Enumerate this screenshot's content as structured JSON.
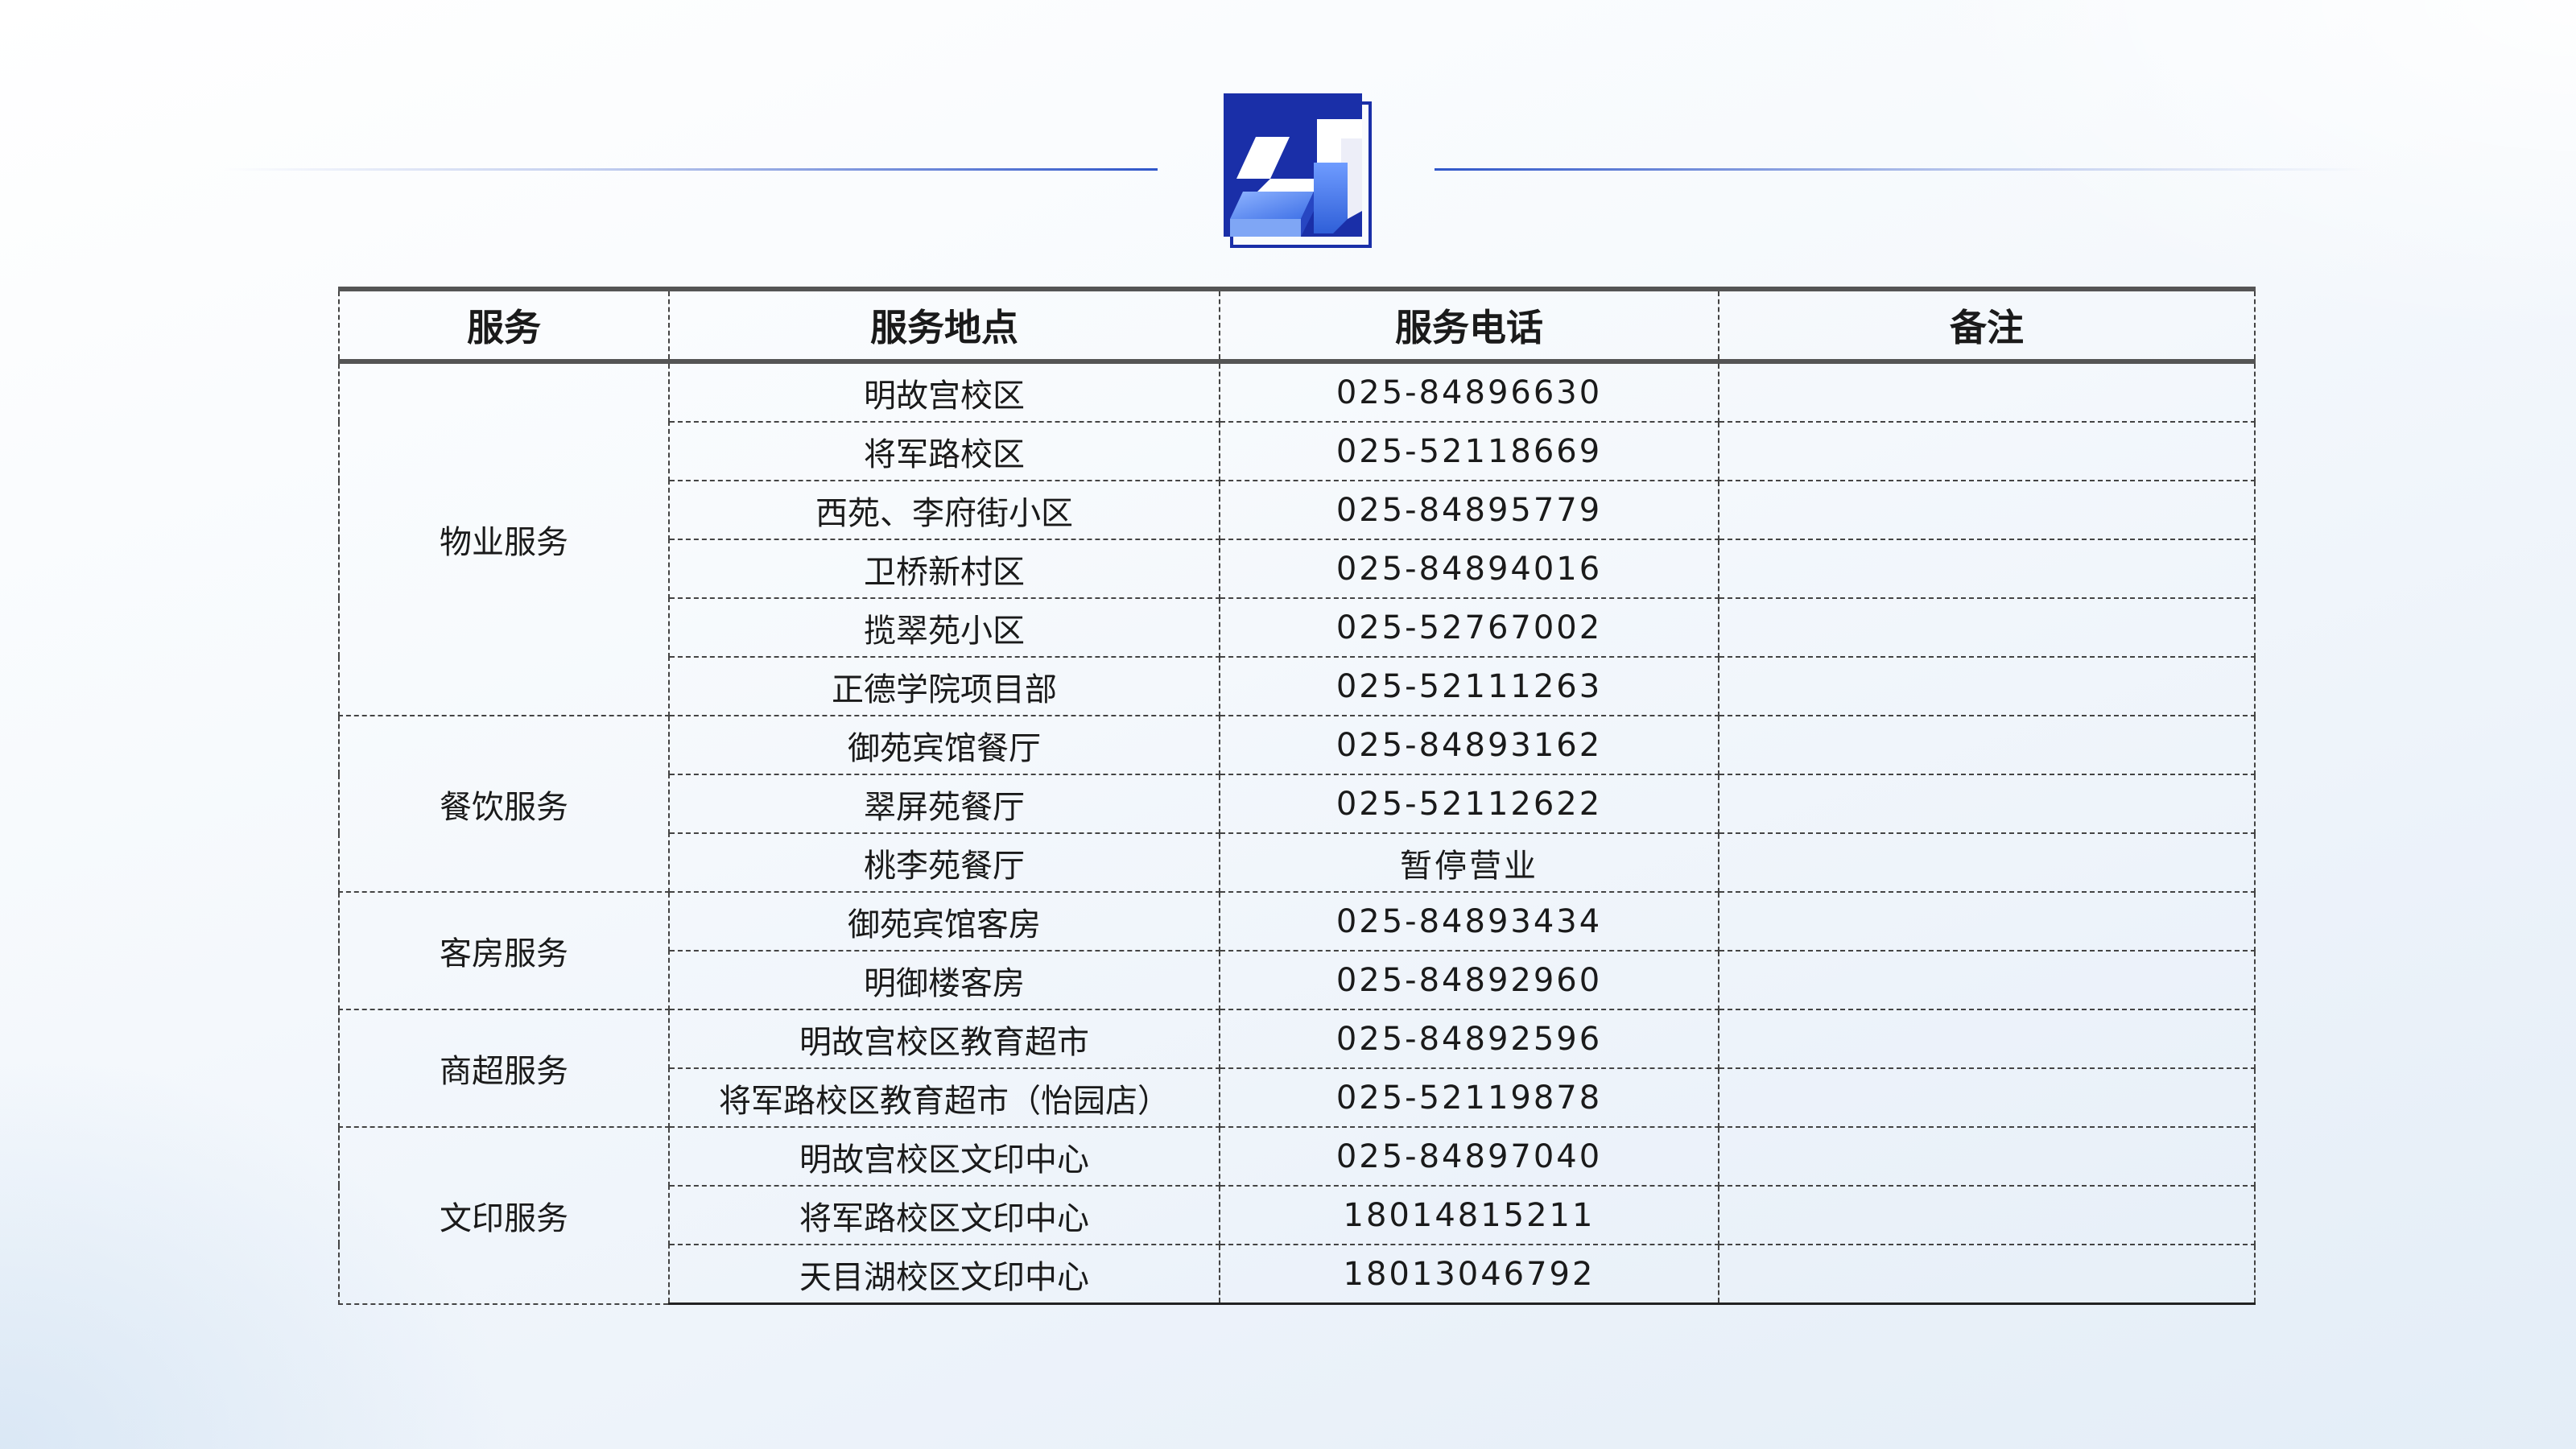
{
  "colors": {
    "accent_blue": "#2f56c9",
    "logo_dark_blue": "#1a2fa8",
    "logo_light_blue": "#5b8ef0",
    "rule_gray": "#555555"
  },
  "logo": {
    "icon": "h-emblem-logo"
  },
  "table": {
    "headers": [
      "服务",
      "服务地点",
      "服务电话",
      "备注"
    ],
    "groups": [
      {
        "service": "物业服务",
        "rows": [
          {
            "location": "明故宫校区",
            "phone": "025-84896630",
            "note": ""
          },
          {
            "location": "将军路校区",
            "phone": "025-52118669",
            "note": ""
          },
          {
            "location": "西苑、李府街小区",
            "phone": "025-84895779",
            "note": ""
          },
          {
            "location": "卫桥新村区",
            "phone": "025-84894016",
            "note": ""
          },
          {
            "location": "揽翠苑小区",
            "phone": "025-52767002",
            "note": ""
          },
          {
            "location": "正德学院项目部",
            "phone": "025-52111263",
            "note": ""
          }
        ]
      },
      {
        "service": "餐饮服务",
        "rows": [
          {
            "location": "御苑宾馆餐厅",
            "phone": "025-84893162",
            "note": ""
          },
          {
            "location": "翠屏苑餐厅",
            "phone": "025-52112622",
            "note": ""
          },
          {
            "location": "桃李苑餐厅",
            "phone": "暂停营业",
            "note": ""
          }
        ]
      },
      {
        "service": "客房服务",
        "rows": [
          {
            "location": "御苑宾馆客房",
            "phone": "025-84893434",
            "note": ""
          },
          {
            "location": "明御楼客房",
            "phone": "025-84892960",
            "note": ""
          }
        ]
      },
      {
        "service": "商超服务",
        "rows": [
          {
            "location": "明故宫校区教育超市",
            "phone": "025-84892596",
            "note": ""
          },
          {
            "location": "将军路校区教育超市（怡园店）",
            "phone": "025-52119878",
            "note": ""
          }
        ]
      },
      {
        "service": "文印服务",
        "rows": [
          {
            "location": "明故宫校区文印中心",
            "phone": "025-84897040",
            "note": ""
          },
          {
            "location": "将军路校区文印中心",
            "phone": "18014815211",
            "note": ""
          },
          {
            "location": "天目湖校区文印中心",
            "phone": "18013046792",
            "note": ""
          }
        ]
      }
    ]
  }
}
